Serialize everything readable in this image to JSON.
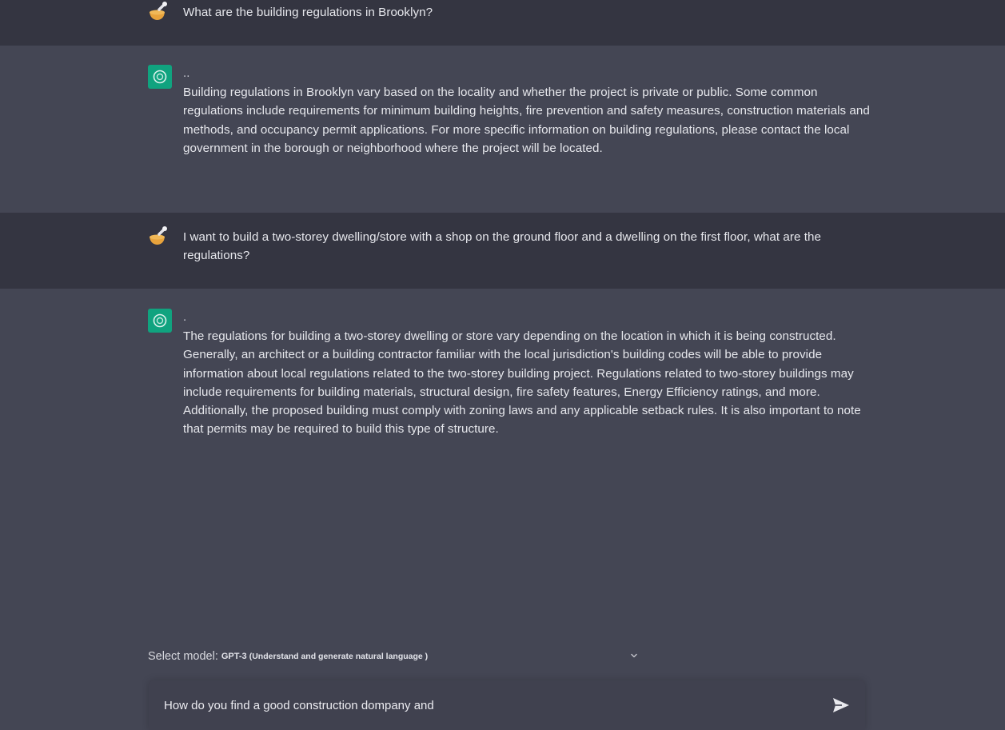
{
  "conversation": {
    "messages": [
      {
        "role": "user",
        "avatar_icon": "user-avatar-icon",
        "text": "What are the building regulations in Brooklyn?"
      },
      {
        "role": "assistant",
        "avatar_icon": "openai-logo-icon",
        "prefix": "..",
        "text": "Building regulations in Brooklyn vary based on the locality and whether the project is private or public. Some common regulations include requirements for minimum building heights, fire prevention and safety measures, construction materials and methods, and occupancy permit applications. For more specific information on building regulations, please contact the local government in the borough or neighborhood where the project will be located."
      },
      {
        "role": "user",
        "avatar_icon": "user-avatar-icon",
        "text": "I want to build a two-storey dwelling/store with a shop on the ground floor and a dwelling on the first floor, what are the regulations?"
      },
      {
        "role": "assistant",
        "avatar_icon": "openai-logo-icon",
        "prefix": ".",
        "text": "The regulations for building a two-storey dwelling or store vary depending on the location in which it is being constructed. Generally, an architect or a building contractor familiar with the local jurisdiction's building codes will be able to provide information about local regulations related to the two-storey building project. Regulations related to two-storey buildings may include requirements for building materials, structural design, fire safety features, Energy Efficiency ratings, and more. Additionally, the proposed building must comply with zoning laws and any applicable setback rules. It is also important to note that permits may be required to build this type of structure."
      }
    ]
  },
  "model_selector": {
    "label": "Select model:",
    "selected_model": "GPT-3",
    "selected_desc": "(Understand and generate natural language )",
    "icon": "chevron-down-icon"
  },
  "composer": {
    "value": "How do you find a good construction dompany and",
    "send_icon": "send-icon"
  },
  "colors": {
    "user_row_bg": "#343541",
    "assistant_row_bg": "#444654",
    "assistant_avatar_bg": "#10a37f",
    "user_avatar_accent": "#e8a33c",
    "composer_bg": "#40414f"
  }
}
